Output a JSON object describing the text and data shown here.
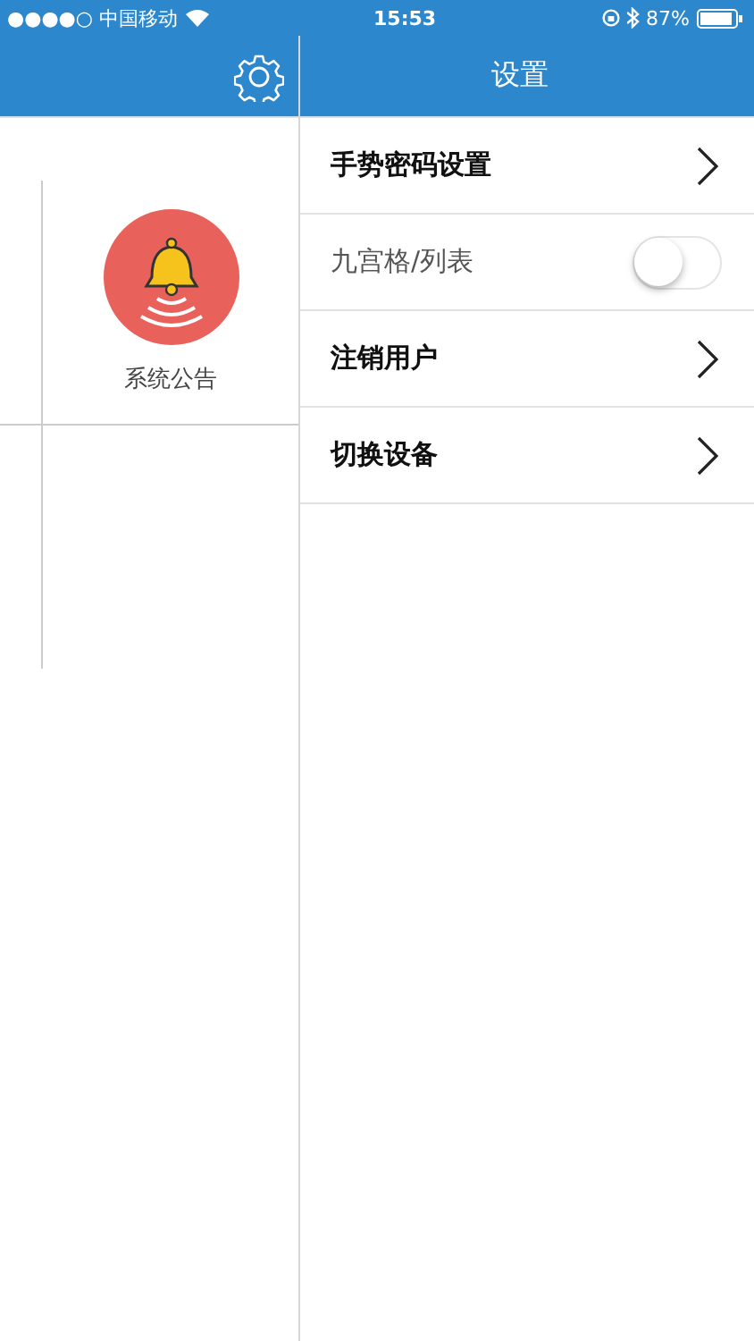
{
  "status_bar": {
    "carrier": "●●●●○ 中国移动",
    "time": "15:53",
    "battery": "87%"
  },
  "sidebar": {
    "cells": [
      {
        "label": "系统公告"
      }
    ]
  },
  "header": {
    "title": "设置"
  },
  "settings": [
    {
      "label": "手势密码设置",
      "kind": "chevron"
    },
    {
      "label": "九宫格/列表",
      "kind": "toggle",
      "on": false
    },
    {
      "label": "注销用户",
      "kind": "chevron"
    },
    {
      "label": "切换设备",
      "kind": "chevron"
    }
  ]
}
